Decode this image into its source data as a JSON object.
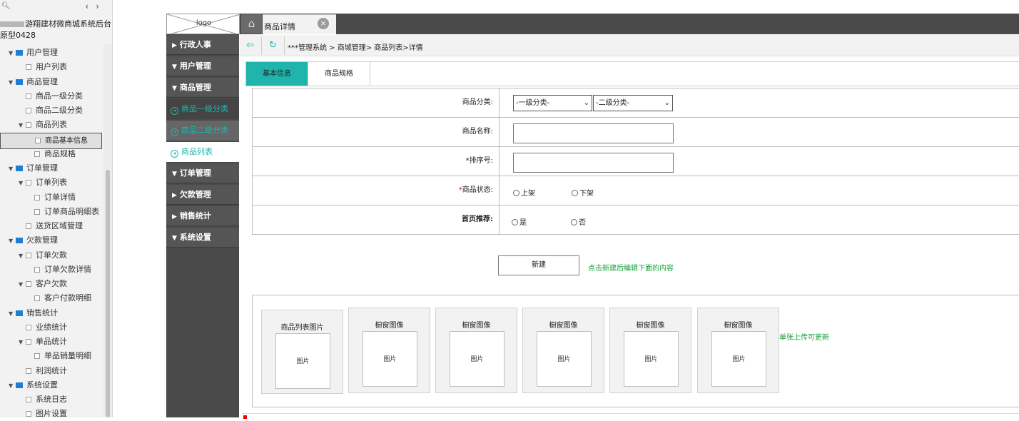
{
  "tree": {
    "project_title": "游翔建材微商城系统后台原型0428",
    "nodes": [
      {
        "label": "用户管理",
        "level": 1,
        "type": "folder"
      },
      {
        "label": "用户列表",
        "level": 2,
        "type": "page"
      },
      {
        "label": "商品管理",
        "level": 1,
        "type": "folder"
      },
      {
        "label": "商品一级分类",
        "level": 2,
        "type": "page"
      },
      {
        "label": "商品二级分类",
        "level": 2,
        "type": "page"
      },
      {
        "label": "商品列表",
        "level": 2,
        "type": "page-expand"
      },
      {
        "label": "商品基本信息",
        "level": 3,
        "type": "page",
        "selected": true
      },
      {
        "label": "商品规格",
        "level": 3,
        "type": "page"
      },
      {
        "label": "订单管理",
        "level": 1,
        "type": "folder"
      },
      {
        "label": "订单列表",
        "level": 2,
        "type": "page-expand"
      },
      {
        "label": "订单详情",
        "level": 3,
        "type": "page"
      },
      {
        "label": "订单商品明细表",
        "level": 3,
        "type": "page"
      },
      {
        "label": "送货区域管理",
        "level": 2,
        "type": "page"
      },
      {
        "label": "欠款管理",
        "level": 1,
        "type": "folder"
      },
      {
        "label": "订单欠款",
        "level": 2,
        "type": "page-expand"
      },
      {
        "label": "订单欠款详情",
        "level": 3,
        "type": "page"
      },
      {
        "label": "客户欠款",
        "level": 2,
        "type": "page-expand"
      },
      {
        "label": "客户付款明细",
        "level": 3,
        "type": "page"
      },
      {
        "label": "销售统计",
        "level": 1,
        "type": "folder"
      },
      {
        "label": "业绩统计",
        "level": 2,
        "type": "page"
      },
      {
        "label": "单品统计",
        "level": 2,
        "type": "page-expand"
      },
      {
        "label": "单品销量明细",
        "level": 3,
        "type": "page"
      },
      {
        "label": "利润统计",
        "level": 2,
        "type": "page"
      },
      {
        "label": "系统设置",
        "level": 1,
        "type": "folder"
      },
      {
        "label": "系统日志",
        "level": 2,
        "type": "page"
      },
      {
        "label": "图片设置",
        "level": 2,
        "type": "page"
      }
    ]
  },
  "app": {
    "logo_text": "logo",
    "side_nav": [
      {
        "label": "行政人事",
        "kind": "group",
        "tri": "▶"
      },
      {
        "label": "用户管理",
        "kind": "group",
        "tri": "▼"
      },
      {
        "label": "商品管理",
        "kind": "group",
        "tri": "▼"
      },
      {
        "label": "商品一级分类",
        "kind": "sub",
        "style": "dark"
      },
      {
        "label": "商品二级分类",
        "kind": "sub",
        "style": "mid"
      },
      {
        "label": "商品列表",
        "kind": "sub",
        "style": "white"
      },
      {
        "label": "订单管理",
        "kind": "group",
        "tri": "▼"
      },
      {
        "label": "欠款管理",
        "kind": "group",
        "tri": "▶"
      },
      {
        "label": "销售统计",
        "kind": "group",
        "tri": "▶"
      },
      {
        "label": "系统设置",
        "kind": "group",
        "tri": "▼"
      }
    ],
    "open_tab": "商品详情",
    "breadcrumb": "***管理系统 > 商城管理> 商品列表>详情",
    "content_tabs": [
      "基本信息",
      "商品规格"
    ],
    "form": {
      "category_label": "商品分类:",
      "category_level1": "-一级分类-",
      "category_level2": "-二级分类-",
      "name_label": "商品名称:",
      "sort_label": "*排序号:",
      "status_label_req": "*",
      "status_label": "商品状态:",
      "status_on": "上架",
      "status_off": "下架",
      "recommend_label": "首页推荐:",
      "recommend_yes": "是",
      "recommend_no": "否"
    },
    "new_button": "新建",
    "new_hint": "点击新建后编辑下面的内容",
    "images": {
      "cards": [
        {
          "title": "商品列表图片",
          "pic": "图片"
        },
        {
          "title": "橱窗图像",
          "pic": "图片"
        },
        {
          "title": "橱窗图像",
          "pic": "图片"
        },
        {
          "title": "橱窗图像",
          "pic": "图片"
        },
        {
          "title": "橱窗图像",
          "pic": "图片"
        },
        {
          "title": "橱窗图像",
          "pic": "图片"
        }
      ],
      "hint": "单张上传可更新"
    }
  },
  "colors": {
    "accent": "#1fb5ad",
    "hint_green": "#159e3b",
    "nav_bg": "#4a4a4a",
    "folder_blue": "#1e7ed3"
  }
}
